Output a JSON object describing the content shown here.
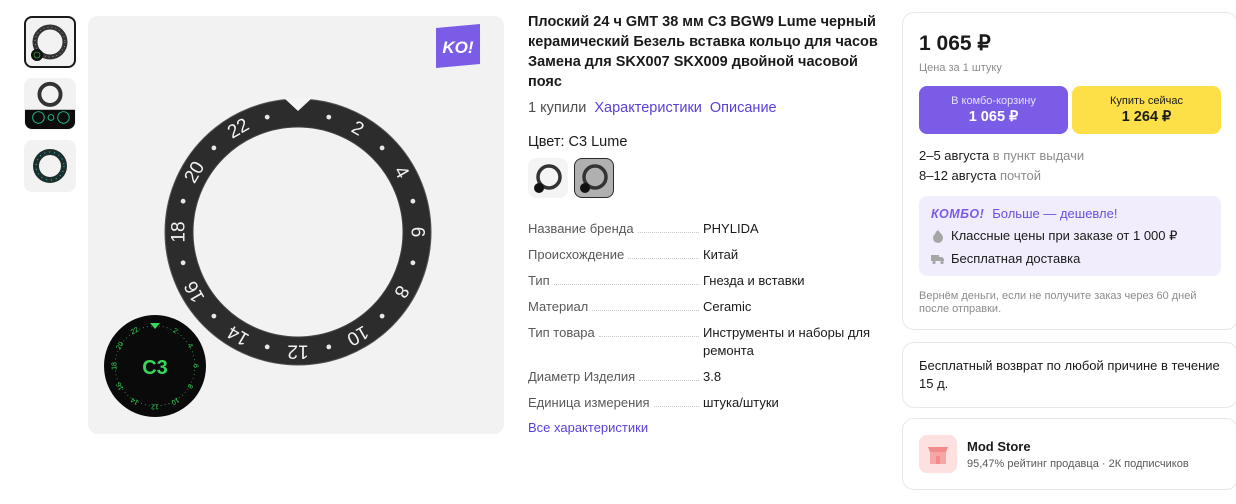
{
  "product": {
    "title": "Плоский 24 ч GMT 38 мм C3 BGW9 Lume черный керамический Безель вставка кольцо для часов Замена для SKX007 SKX009 двойной часовой пояс",
    "bought": "1 купили",
    "link_specs": "Характеристики",
    "link_description": "Описание",
    "color_label": "Цвет: C3 Lume",
    "bezel_numbers": [
      "2",
      "4",
      "6",
      "8",
      "10",
      "12",
      "14",
      "16",
      "18",
      "20",
      "22"
    ],
    "lume_label": "C3"
  },
  "specs": [
    {
      "key": "Название бренда",
      "value": "PHYLIDA"
    },
    {
      "key": "Происхождение",
      "value": "Китай"
    },
    {
      "key": "Тип",
      "value": "Гнезда и вставки"
    },
    {
      "key": "Материал",
      "value": "Ceramic"
    },
    {
      "key": "Тип товара",
      "value": "Инструменты и наборы для ремонта"
    },
    {
      "key": "Диаметр Изделия",
      "value": "3.8"
    },
    {
      "key": "Единица измерения",
      "value": "штука/штуки"
    }
  ],
  "all_specs_link": "Все характеристики",
  "badge": {
    "text": "KO!",
    "color": "#7b5ce6"
  },
  "buy": {
    "price": "1 065 ₽",
    "price_sub": "Цена за 1 штуку",
    "combo_btn_top": "В комбо-корзину",
    "combo_btn_price": "1 065 ₽",
    "buy_btn_top": "Купить сейчас",
    "buy_btn_price": "1 264 ₽",
    "delivery1_date": "2–5 августа",
    "delivery1_where": "в пункт выдачи",
    "delivery2_date": "8–12 августа",
    "delivery2_where": "почтой",
    "combo_logo": "КОМБО!",
    "combo_head": "Больше — дешевле!",
    "combo_line1": "Классные цены при заказе от 1 000 ₽",
    "combo_line2": "Бесплатная доставка",
    "refund": "Вернём деньги, если не получите заказ через 60 дней после отправки."
  },
  "return_text": "Бесплатный возврат по любой причине в течение 15 д.",
  "store": {
    "name": "Mod Store",
    "meta": "95,47% рейтинг продавца · 2К подписчиков"
  },
  "colors": {
    "accent": "#5a3fd8",
    "combo": "#7b5ce6",
    "buy": "#fde047",
    "lume": "#39d65a"
  }
}
